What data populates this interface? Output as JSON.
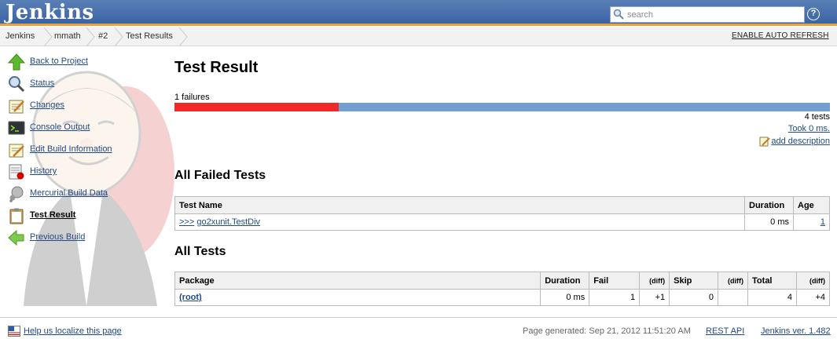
{
  "header": {
    "logo": "Jenkins",
    "search_placeholder": "search",
    "help_label": "?"
  },
  "breadcrumb": {
    "items": [
      "Jenkins",
      "mmath",
      "#2",
      "Test Results"
    ],
    "auto_refresh": "ENABLE AUTO REFRESH"
  },
  "sidebar": {
    "items": [
      {
        "label": "Back to Project",
        "icon": "up-arrow-icon"
      },
      {
        "label": "Status",
        "icon": "magnifier-icon"
      },
      {
        "label": "Changes",
        "icon": "notepad-icon"
      },
      {
        "label": "Console Output",
        "icon": "terminal-icon"
      },
      {
        "label": "Edit Build Information",
        "icon": "notepad-edit-icon"
      },
      {
        "label": "History",
        "icon": "history-icon"
      },
      {
        "label": "Mercurial Build Data",
        "icon": "mercurial-icon"
      },
      {
        "label": "Test Result",
        "icon": "clipboard-icon"
      },
      {
        "label": "Previous Build",
        "icon": "left-arrow-icon"
      }
    ],
    "active_index": 7
  },
  "main": {
    "title": "Test Result",
    "failures_text": "1 failures",
    "fail_fraction": 0.25,
    "tests_text": "4 tests",
    "took_text": "Took 0 ms.",
    "add_description": "add description",
    "failed_section": {
      "title": "All Failed Tests",
      "headers": [
        "Test Name",
        "Duration",
        "Age"
      ],
      "rows": [
        {
          "prefix": ">>>",
          "name": "go2xunit.TestDiv",
          "duration": "0 ms",
          "age": "1"
        }
      ]
    },
    "all_section": {
      "title": "All Tests",
      "headers": [
        "Package",
        "Duration",
        "Fail",
        "(diff)",
        "Skip",
        "(diff)",
        "Total",
        "(diff)"
      ],
      "rows": [
        {
          "package": "(root)",
          "duration": "0 ms",
          "fail": "1",
          "fail_diff": "+1",
          "skip": "0",
          "skip_diff": "",
          "total": "4",
          "total_diff": "+4"
        }
      ]
    }
  },
  "footer": {
    "localize": "Help us localize this page",
    "generated": "Page generated: Sep 21, 2012 11:51:20 AM",
    "rest_api": "REST API",
    "version": "Jenkins ver. 1.482"
  }
}
